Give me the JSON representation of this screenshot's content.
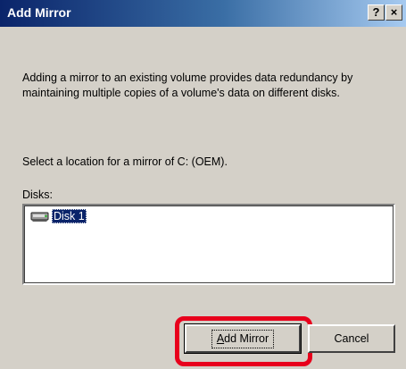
{
  "dialog": {
    "title": "Add Mirror",
    "help_label": "?",
    "close_label": "×"
  },
  "description": "Adding a mirror to an existing volume provides data redundancy by maintaining multiple copies of a volume's data on different disks.",
  "select_prompt": "Select a location for a mirror of C: (OEM).",
  "disks": {
    "label": "Disks:",
    "items": [
      {
        "label": "Disk 1",
        "icon": "disk-drive-icon",
        "selected": true
      }
    ]
  },
  "buttons": {
    "add_mirror": "Add Mirror",
    "cancel": "Cancel"
  },
  "colors": {
    "titlebar_start": "#0a246a",
    "titlebar_end": "#a6caf0",
    "selection": "#0a246a",
    "highlight_ring": "#e8001c",
    "dialog_face": "#d4d0c8"
  }
}
